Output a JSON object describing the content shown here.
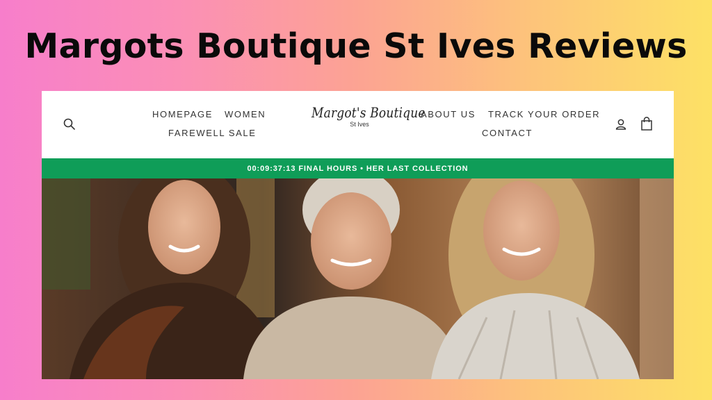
{
  "headline": "Margots Boutique St Ives Reviews",
  "nav": {
    "left": [
      "HOMEPAGE",
      "WOMEN",
      "FAREWELL SALE"
    ],
    "right": [
      "ABOUT US",
      "TRACK YOUR ORDER",
      "CONTACT"
    ]
  },
  "logo": {
    "main": "Margot's Boutique",
    "sub": "St Ives"
  },
  "announcement": {
    "countdown": "00:09:37:13",
    "text": "FINAL HOURS • HER LAST COLLECTION",
    "bg_color": "#0f9d58"
  },
  "icons": {
    "search": "search-icon",
    "account": "user-icon",
    "cart": "shopping-bag-icon"
  },
  "hero": {
    "description_colors": {
      "backdrop": "#6b4a33",
      "sweater": "#c9b8a3",
      "shirt": "#d9d4cc"
    }
  }
}
